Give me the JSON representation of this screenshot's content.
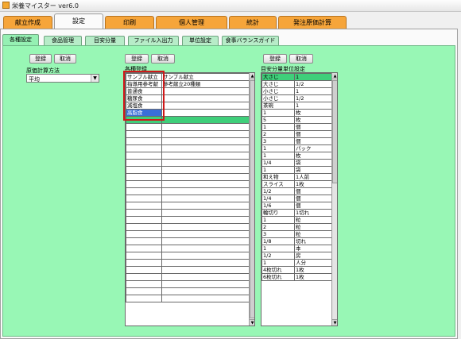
{
  "window": {
    "title": "栄養マイスター ver6.0"
  },
  "main_tabs": [
    {
      "label": "献立作成",
      "active": false
    },
    {
      "label": "設定",
      "active": true
    },
    {
      "label": "印刷",
      "active": false
    },
    {
      "label": "個人管理",
      "active": false
    },
    {
      "label": "統計",
      "active": false
    },
    {
      "label": "発注原価計算",
      "active": false
    }
  ],
  "sub_tabs": [
    {
      "label": "各種設定",
      "active": true
    },
    {
      "label": "食品管理",
      "active": false
    },
    {
      "label": "目安分量",
      "active": false
    },
    {
      "label": "ファイル入出力",
      "active": false
    },
    {
      "label": "単位設定",
      "active": false
    },
    {
      "label": "食事バランスガイド",
      "active": false
    }
  ],
  "left_section": {
    "register_label": "登録",
    "cancel_label": "取消",
    "cost_method_label": "原価計算方法",
    "cost_method_value": "平均"
  },
  "middle_section": {
    "register_label": "登録",
    "cancel_label": "取消",
    "heading": "各種登録",
    "rows": [
      [
        "サンプル献立",
        "サンプル献立"
      ],
      [
        "指導用参考献",
        "参考献立20種類"
      ],
      [
        "普通食",
        ""
      ],
      [
        "糖尿食",
        ""
      ],
      [
        "減塩食",
        ""
      ],
      [
        "高脂食",
        ""
      ],
      [
        "",
        ""
      ],
      [
        "",
        ""
      ],
      [
        "",
        ""
      ],
      [
        "",
        ""
      ],
      [
        "",
        ""
      ],
      [
        "",
        ""
      ],
      [
        "",
        ""
      ],
      [
        "",
        ""
      ],
      [
        "",
        ""
      ],
      [
        "",
        ""
      ],
      [
        "",
        ""
      ],
      [
        "",
        ""
      ],
      [
        "",
        ""
      ],
      [
        "",
        ""
      ],
      [
        "",
        ""
      ],
      [
        "",
        ""
      ],
      [
        "",
        ""
      ],
      [
        "",
        ""
      ],
      [
        "",
        ""
      ],
      [
        "",
        ""
      ],
      [
        "",
        ""
      ],
      [
        "",
        ""
      ],
      [
        "",
        ""
      ],
      [
        "",
        ""
      ],
      [
        "",
        ""
      ],
      [
        "",
        ""
      ]
    ],
    "selected_row": 5,
    "highlight_row": 6
  },
  "right_section": {
    "register_label": "登録",
    "cancel_label": "取消",
    "heading": "目安分量単位設定",
    "rows": [
      [
        "大さじ",
        "1"
      ],
      [
        "大さじ",
        "1/2"
      ],
      [
        "小さじ",
        "1"
      ],
      [
        "小さじ",
        "1/2"
      ],
      [
        "茶碗",
        "1"
      ],
      [
        "1",
        "枚"
      ],
      [
        "5",
        "枚"
      ],
      [
        "1",
        "個"
      ],
      [
        "2",
        "個"
      ],
      [
        "3",
        "個"
      ],
      [
        "1",
        "パック"
      ],
      [
        "1",
        "枚"
      ],
      [
        "1/4",
        "袋"
      ],
      [
        "1",
        "袋"
      ],
      [
        "和え物",
        "1人前"
      ],
      [
        "スライス",
        "1枚"
      ],
      [
        "1/2",
        "個"
      ],
      [
        "1/4",
        "個"
      ],
      [
        "1/6",
        "個"
      ],
      [
        "輪切り",
        "1切れ"
      ],
      [
        "1",
        "粒"
      ],
      [
        "2",
        "粒"
      ],
      [
        "3",
        "粒"
      ],
      [
        "1/8",
        "切れ"
      ],
      [
        "1",
        "本"
      ],
      [
        "1/2",
        "房"
      ],
      [
        "1",
        "人分"
      ],
      [
        "4枚切れ",
        "1枚"
      ],
      [
        "6枚切れ",
        "1枚"
      ]
    ],
    "highlight_row": 0
  },
  "colors": {
    "content_bg": "#98f7b5",
    "highlight_row": "#3fcf7a",
    "main_tab": "#f6a53a",
    "annotation_box": "#d01818"
  }
}
